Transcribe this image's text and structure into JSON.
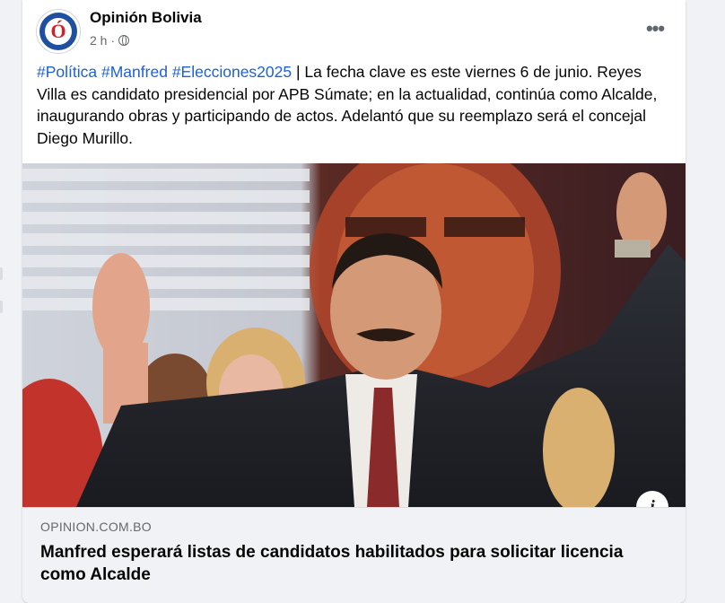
{
  "post": {
    "page_name": "Opinión Bolivia",
    "time": "2 h",
    "audience_icon": "globe-icon",
    "avatar_letter": "Ó",
    "hashtags": [
      "#Política",
      "#Manfred",
      "#Elecciones2025"
    ],
    "separator": "|",
    "text": "La fecha clave es este viernes 6 de junio. Reyes Villa es candidato presidencial por APB Súmate; en la actualidad, continúa como Alcalde, inaugurando obras y participando de actos. Adelantó que su reemplazo será el concejal Diego Murillo.",
    "more_icon": "•••"
  },
  "link_preview": {
    "domain": "OPINION.COM.BO",
    "title": "Manfred esperará listas de candidatos habilitados para solicitar licencia como Alcalde",
    "info_icon": "i"
  },
  "colors": {
    "hashtag": "#1d61d6",
    "text": "#050505",
    "secondary": "#65676b",
    "avatar_ring": "#1e4fa0",
    "avatar_letter": "#d0202a"
  }
}
